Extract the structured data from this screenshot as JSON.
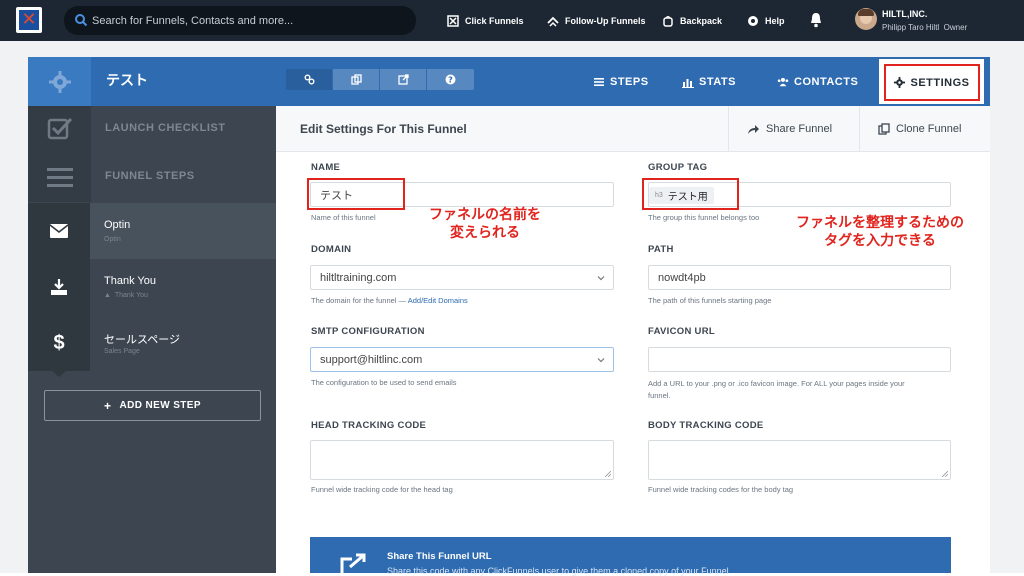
{
  "topbar": {
    "search_placeholder": "Search for Funnels, Contacts and more...",
    "nav": [
      {
        "label": "Click Funnels",
        "icon": "clickfunnels-icon"
      },
      {
        "label": "Follow-Up Funnels",
        "icon": "follow-up-icon"
      },
      {
        "label": "Backpack",
        "icon": "backpack-icon"
      },
      {
        "label": "Help",
        "icon": "help-icon"
      }
    ],
    "account_name": "HILTL,INC.",
    "account_user": "Philipp Taro Hiltl",
    "account_role": "Owner"
  },
  "funnel": {
    "title": "テスト",
    "tabs": {
      "steps": "STEPS",
      "stats": "STATS",
      "contacts": "CONTACTS",
      "settings": "SETTINGS"
    }
  },
  "sidebar": {
    "launch_checklist": "LAUNCH CHECKLIST",
    "funnel_steps": "FUNNEL STEPS",
    "steps": [
      {
        "title": "Optin",
        "subtitle": "Optin"
      },
      {
        "title": "Thank You",
        "subtitle": "Thank You"
      },
      {
        "title": "セールスページ",
        "subtitle": "Sales Page"
      }
    ],
    "add_new_step": "ADD NEW STEP"
  },
  "main": {
    "title": "Edit Settings For This Funnel",
    "share_funnel": "Share Funnel",
    "clone_funnel": "Clone Funnel",
    "name": {
      "label": "NAME",
      "value": "テスト",
      "help": "Name of this funnel"
    },
    "group_tag": {
      "label": "GROUP TAG",
      "tag_prefix": "h3",
      "tag_value": "テスト用",
      "help": "The group this funnel belongs too"
    },
    "domain": {
      "label": "DOMAIN",
      "value": "hiltltraining.com",
      "help": "The domain for the funnel — ",
      "help_link": "Add/Edit Domains"
    },
    "path": {
      "label": "PATH",
      "value": "nowdt4pb",
      "help": "The path of this funnels starting page"
    },
    "smtp": {
      "label": "SMTP CONFIGURATION",
      "value": "support@hiltlinc.com",
      "help": "The configuration to be used to send emails"
    },
    "favicon": {
      "label": "FAVICON URL",
      "value": "",
      "help_line1": "Add a URL to your .png or .ico favicon image. For ALL your pages inside your",
      "help_line2": "funnel."
    },
    "head_tracking": {
      "label": "HEAD TRACKING CODE",
      "help": "Funnel wide tracking code for the head tag"
    },
    "body_tracking": {
      "label": "BODY TRACKING CODE",
      "help": "Funnel wide tracking codes for the body tag"
    },
    "share_url": {
      "title": "Share This Funnel URL",
      "subtitle": "Share this code with any ClickFunnels user to give them a cloned copy of your Funnel"
    }
  },
  "annotations": {
    "name_line1": "ファネルの名前を",
    "name_line2": "変えられる",
    "tag_line1": "ファネルを整理するための",
    "tag_line2": "タグを入力できる"
  },
  "colors": {
    "topbar": "#1d2733",
    "brand_blue": "#2e6bb1",
    "sidebar": "#3d4650",
    "highlight_red": "#e0231d"
  }
}
